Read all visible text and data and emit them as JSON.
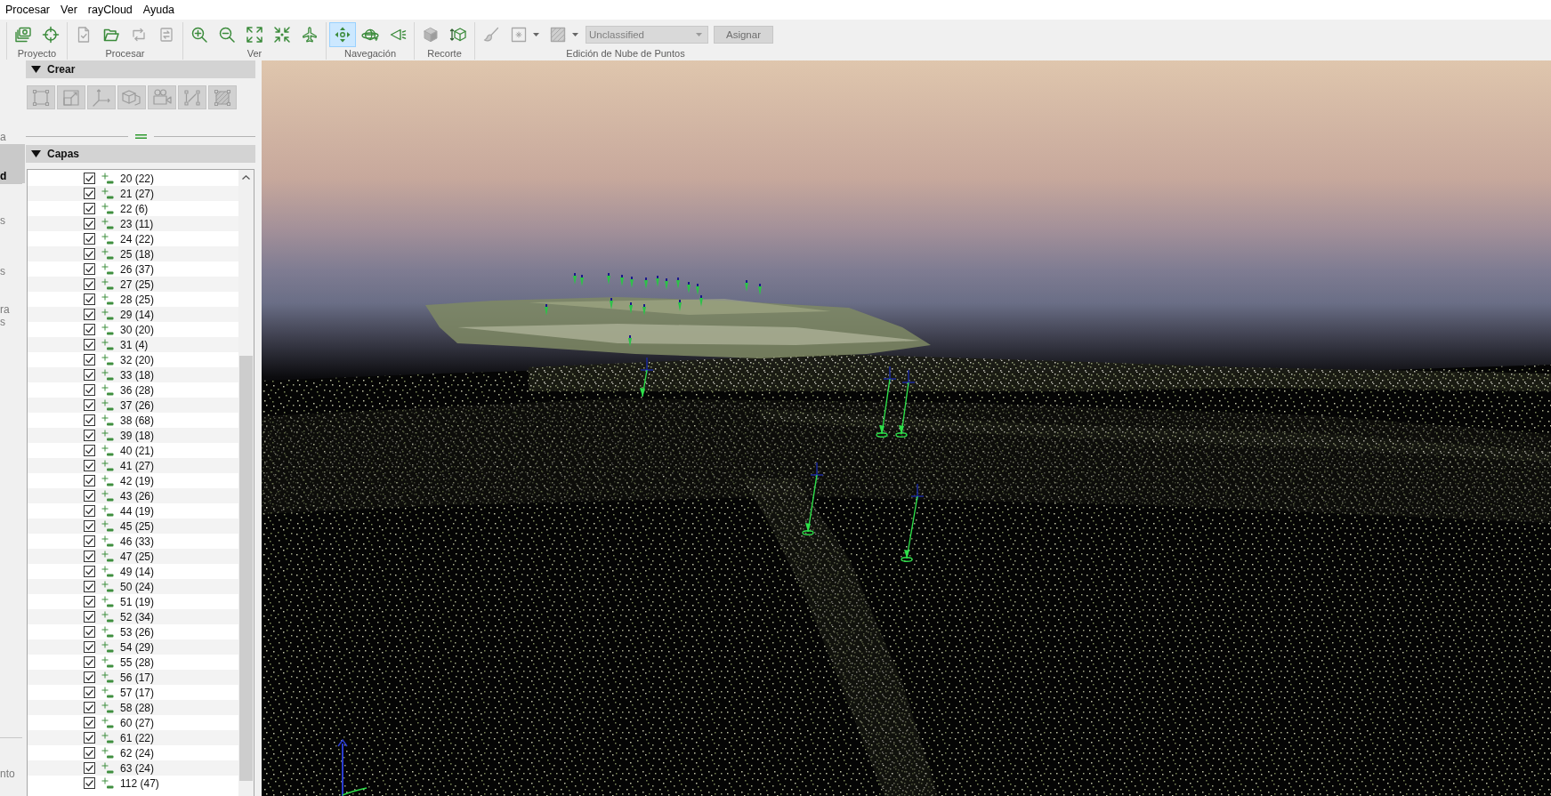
{
  "menu": [
    "Procesar",
    "Ver",
    "rayCloud",
    "Ayuda"
  ],
  "toolbar": {
    "groups": [
      {
        "label": "Proyecto",
        "tools": [
          {
            "kind": "icon",
            "disabled": false
          },
          {
            "kind": "icon",
            "disabled": false
          }
        ]
      },
      {
        "label": "Procesar",
        "tools": [
          {
            "kind": "icon",
            "disabled": true
          },
          {
            "kind": "icon",
            "disabled": false
          },
          {
            "kind": "icon",
            "disabled": true
          },
          {
            "kind": "icon",
            "disabled": true
          }
        ]
      },
      {
        "label": "Ver",
        "tools": [
          {
            "kind": "icon",
            "disabled": false
          },
          {
            "kind": "icon",
            "disabled": false
          },
          {
            "kind": "icon",
            "disabled": false
          },
          {
            "kind": "icon",
            "disabled": false
          },
          {
            "kind": "icon",
            "disabled": false
          }
        ]
      },
      {
        "label": "Navegación",
        "tools": [
          {
            "kind": "icon",
            "disabled": false,
            "selected": true
          },
          {
            "kind": "icon",
            "disabled": false,
            "selected": false
          },
          {
            "kind": "icon",
            "disabled": false,
            "selected": false
          }
        ]
      },
      {
        "label": "Recorte",
        "tools": [
          {
            "kind": "icon",
            "disabled": true
          },
          {
            "kind": "icon",
            "disabled": false
          }
        ]
      },
      {
        "label": "Edición de Nube de Puntos",
        "tools": [
          {
            "kind": "icon",
            "disabled": true
          },
          {
            "kind": "dropdown-icon",
            "disabled": true
          },
          {
            "kind": "dropdown-icon",
            "disabled": true
          },
          {
            "kind": "select",
            "value": "Unclassified",
            "disabled": true
          },
          {
            "kind": "button",
            "label": "Asignar",
            "disabled": true
          }
        ]
      }
    ]
  },
  "view_tabs": [
    {
      "lines": [
        "a"
      ],
      "selected": false
    },
    {
      "lines": [
        "d"
      ],
      "selected": true
    },
    {
      "lines": [
        "s"
      ],
      "selected": false
    },
    {
      "lines": [
        "s"
      ],
      "selected": false
    },
    {
      "lines": [
        "ra",
        "s"
      ],
      "selected": false
    },
    {
      "lines": [
        "nto"
      ],
      "selected": false
    }
  ],
  "crear": {
    "title": "Crear",
    "expanded": true,
    "tools": [
      {
        "disabled": true
      },
      {
        "disabled": true
      },
      {
        "disabled": true
      },
      {
        "disabled": true
      },
      {
        "disabled": true
      },
      {
        "disabled": true
      },
      {
        "disabled": true
      }
    ]
  },
  "capas": {
    "title": "Capas",
    "expanded": true,
    "layers": [
      {
        "label": "20 (22)",
        "checked": true
      },
      {
        "label": "21 (27)",
        "checked": true
      },
      {
        "label": "22 (6)",
        "checked": true
      },
      {
        "label": "23 (11)",
        "checked": true
      },
      {
        "label": "24 (22)",
        "checked": true
      },
      {
        "label": "25 (18)",
        "checked": true
      },
      {
        "label": "26 (37)",
        "checked": true
      },
      {
        "label": "27 (25)",
        "checked": true
      },
      {
        "label": "28 (25)",
        "checked": true
      },
      {
        "label": "29 (14)",
        "checked": true
      },
      {
        "label": "30 (20)",
        "checked": true
      },
      {
        "label": "31 (4)",
        "checked": true
      },
      {
        "label": "32 (20)",
        "checked": true
      },
      {
        "label": "33 (18)",
        "checked": true
      },
      {
        "label": "36 (28)",
        "checked": true
      },
      {
        "label": "37 (26)",
        "checked": true
      },
      {
        "label": "38 (68)",
        "checked": true
      },
      {
        "label": "39 (18)",
        "checked": true
      },
      {
        "label": "40 (21)",
        "checked": true
      },
      {
        "label": "41 (27)",
        "checked": true
      },
      {
        "label": "42 (19)",
        "checked": true
      },
      {
        "label": "43 (26)",
        "checked": true
      },
      {
        "label": "44 (19)",
        "checked": true
      },
      {
        "label": "45 (25)",
        "checked": true
      },
      {
        "label": "46 (33)",
        "checked": true
      },
      {
        "label": "47 (25)",
        "checked": true
      },
      {
        "label": "49 (14)",
        "checked": true
      },
      {
        "label": "50 (24)",
        "checked": true
      },
      {
        "label": "51 (19)",
        "checked": true
      },
      {
        "label": "52 (34)",
        "checked": true
      },
      {
        "label": "53 (26)",
        "checked": true
      },
      {
        "label": "54 (29)",
        "checked": true
      },
      {
        "label": "55 (28)",
        "checked": true
      },
      {
        "label": "56 (17)",
        "checked": true
      },
      {
        "label": "57 (17)",
        "checked": true
      },
      {
        "label": "58 (28)",
        "checked": true
      },
      {
        "label": "60 (27)",
        "checked": true
      },
      {
        "label": "61 (22)",
        "checked": true
      },
      {
        "label": "62 (24)",
        "checked": true
      },
      {
        "label": "63 (24)",
        "checked": true
      },
      {
        "label": "112 (47)",
        "checked": true
      }
    ]
  }
}
